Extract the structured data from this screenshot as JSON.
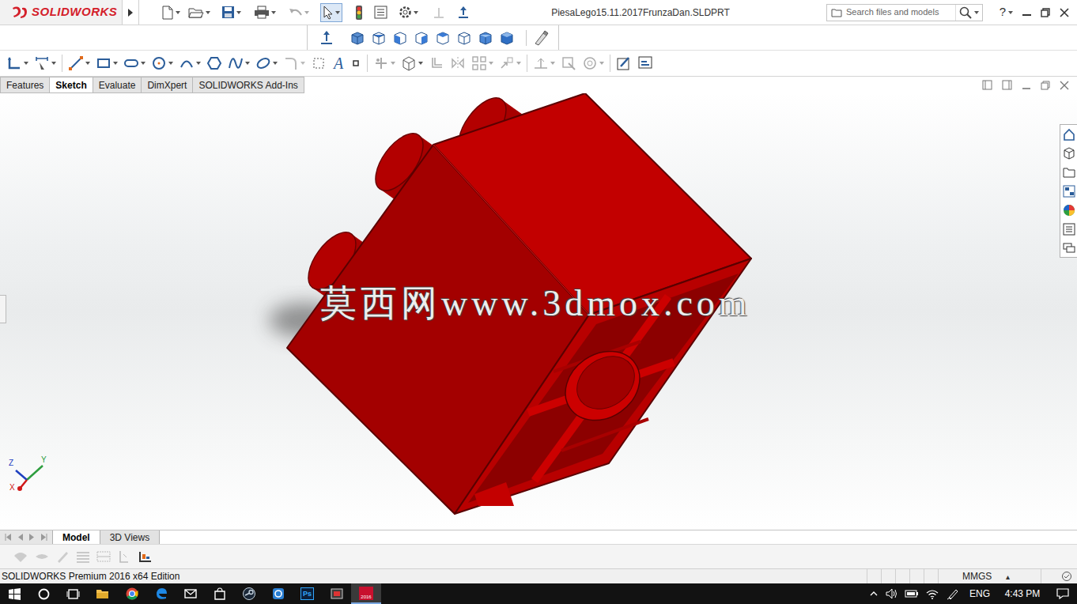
{
  "app": {
    "brand": "SOLIDWORKS"
  },
  "window": {
    "title": "PiesaLego15.11.2017FrunzaDan.SLDPRT"
  },
  "search": {
    "placeholder": "Search files and models"
  },
  "help": "?",
  "sketch_toolbar": {
    "text_tool": "A"
  },
  "tabs": [
    {
      "label": "Features",
      "selected": false
    },
    {
      "label": "Sketch",
      "selected": true
    },
    {
      "label": "Evaluate",
      "selected": false
    },
    {
      "label": "DimXpert",
      "selected": false
    },
    {
      "label": "SOLIDWORKS Add-Ins",
      "selected": false
    }
  ],
  "graphics": {
    "watermark": "莫西网www.3dmox.com",
    "triad": {
      "z": "Z",
      "y": "Y",
      "x": "X"
    }
  },
  "bottom_tabs": [
    {
      "label": "Model",
      "selected": true
    },
    {
      "label": "3D Views",
      "selected": false
    }
  ],
  "status_bar": {
    "edition": "SOLIDWORKS Premium 2016 x64 Edition",
    "units": "MMGS",
    "units_arrow": "▴"
  },
  "taskbar": {
    "photoshop_label": "Ps",
    "solidworks_label": "2016",
    "language": "ENG",
    "time": "4:43 PM"
  }
}
